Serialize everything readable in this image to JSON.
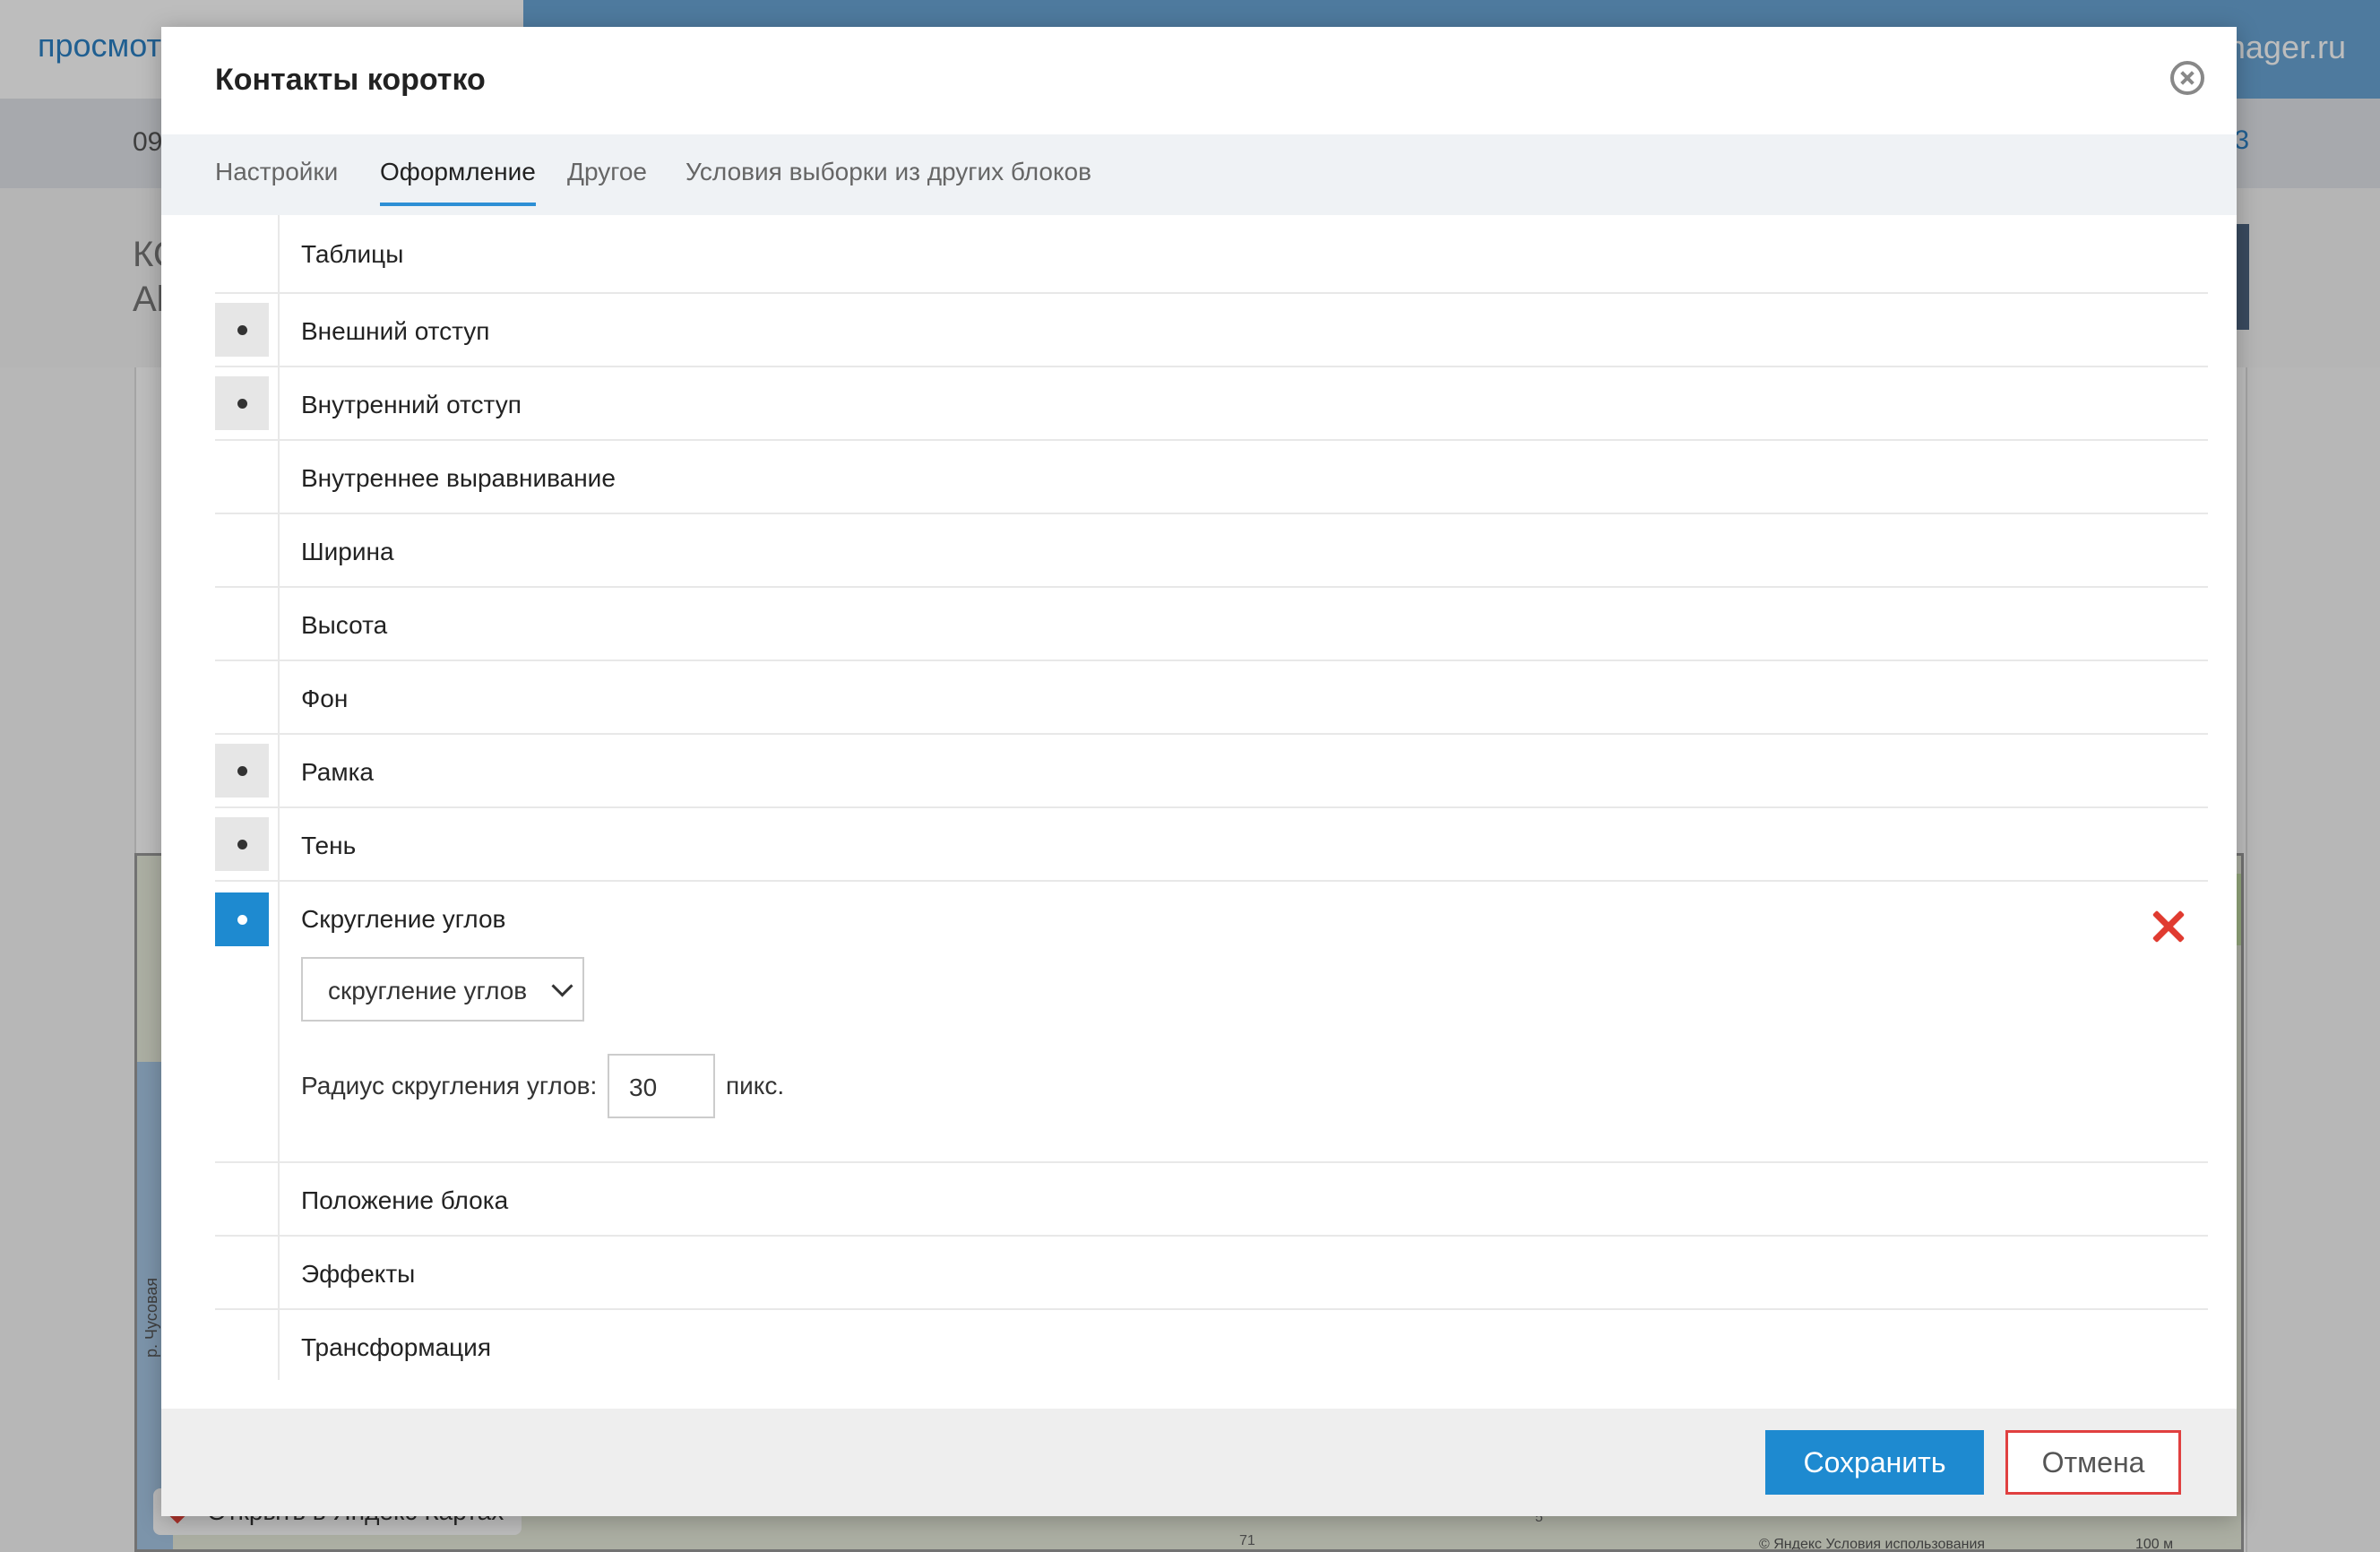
{
  "background": {
    "top_left_text": "просмот",
    "top_right_text": "nager.ru",
    "subbar_left": "09",
    "subbar_right": "3",
    "header_line1": "КС",
    "header_line2": "Al",
    "map": {
      "river_label": "р. Чусовая",
      "open_link": "Открыть в Яндекс Картах",
      "num_71": "71",
      "num_5": "5",
      "copyright": "© Яндекс  Условия использования",
      "scale": "100 м"
    }
  },
  "modal": {
    "title": "Контакты коротко",
    "tabs": [
      {
        "label": "Настройки"
      },
      {
        "label": "Оформление"
      },
      {
        "label": "Другое"
      },
      {
        "label": "Условия выборки из других блоков"
      }
    ],
    "active_tab": "Оформление",
    "rows": [
      {
        "label": "Таблицы",
        "enabled": false
      },
      {
        "label": "Внешний отступ",
        "enabled": true
      },
      {
        "label": "Внутренний отступ",
        "enabled": true
      },
      {
        "label": "Внутреннее выравнивание",
        "enabled": false
      },
      {
        "label": "Ширина",
        "enabled": false
      },
      {
        "label": "Высота",
        "enabled": false
      },
      {
        "label": "Фон",
        "enabled": false
      },
      {
        "label": "Рамка",
        "enabled": true
      },
      {
        "label": "Тень",
        "enabled": true
      },
      {
        "label": "Скругление углов",
        "enabled": true,
        "expanded": true
      },
      {
        "label": "Положение блока",
        "enabled": false
      },
      {
        "label": "Эффекты",
        "enabled": false
      },
      {
        "label": "Трансформация",
        "enabled": false
      }
    ],
    "rounding": {
      "select_value": "скругление углов",
      "radius_label": "Радиус скругления углов:",
      "radius_value": "30",
      "radius_unit": "пикс."
    },
    "footer": {
      "save_label": "Сохранить",
      "cancel_label": "Отмена"
    }
  },
  "colors": {
    "accent": "#1e8ad0",
    "remove_icon": "#e03b30",
    "cancel_border": "#e04040"
  }
}
